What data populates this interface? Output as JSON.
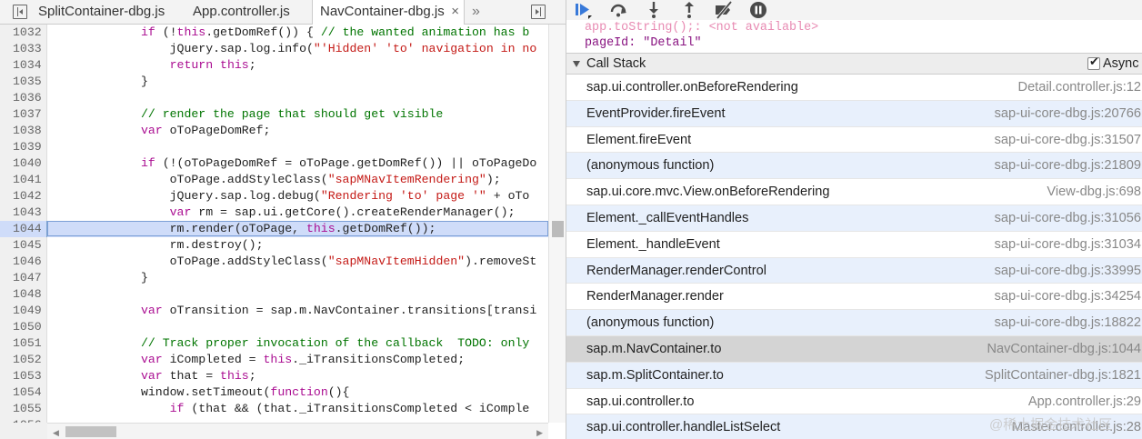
{
  "editor": {
    "tabs": [
      {
        "label": "SplitContainer-dbg.js",
        "active": false
      },
      {
        "label": "App.controller.js",
        "active": false
      },
      {
        "label": "NavContainer-dbg.js",
        "active": true
      }
    ],
    "tab_close": "×",
    "tab_overflow": "»",
    "code_lines": [
      {
        "num": "1032",
        "text": "            if (!this.getDomRef()) { // the wanted animation has b"
      },
      {
        "num": "1033",
        "text": "                jQuery.sap.log.info(\"'Hidden' 'to' navigation in no"
      },
      {
        "num": "1034",
        "text": "                return this;"
      },
      {
        "num": "1035",
        "text": "            }"
      },
      {
        "num": "1036",
        "text": ""
      },
      {
        "num": "1037",
        "text": "            // render the page that should get visible"
      },
      {
        "num": "1038",
        "text": "            var oToPageDomRef;"
      },
      {
        "num": "1039",
        "text": ""
      },
      {
        "num": "1040",
        "text": "            if (!(oToPageDomRef = oToPage.getDomRef()) || oToPageDo"
      },
      {
        "num": "1041",
        "text": "                oToPage.addStyleClass(\"sapMNavItemRendering\");"
      },
      {
        "num": "1042",
        "text": "                jQuery.sap.log.debug(\"Rendering 'to' page '\" + oTo"
      },
      {
        "num": "1043",
        "text": "                var rm = sap.ui.getCore().createRenderManager();"
      },
      {
        "num": "1044",
        "text": "                rm.render(oToPage, this.getDomRef());"
      },
      {
        "num": "1045",
        "text": "                rm.destroy();"
      },
      {
        "num": "1046",
        "text": "                oToPage.addStyleClass(\"sapMNavItemHidden\").removeSt"
      },
      {
        "num": "1047",
        "text": "            }"
      },
      {
        "num": "1048",
        "text": ""
      },
      {
        "num": "1049",
        "text": "            var oTransition = sap.m.NavContainer.transitions[transi"
      },
      {
        "num": "1050",
        "text": ""
      },
      {
        "num": "1051",
        "text": "            // Track proper invocation of the callback  TODO: only"
      },
      {
        "num": "1052",
        "text": "            var iCompleted = this._iTransitionsCompleted;"
      },
      {
        "num": "1053",
        "text": "            var that = this;"
      },
      {
        "num": "1054",
        "text": "            window.setTimeout(function(){"
      },
      {
        "num": "1055",
        "text": "                if (that && (that._iTransitionsCompleted < iComple"
      },
      {
        "num": "1056",
        "text": ""
      }
    ],
    "highlighted_line": "1044"
  },
  "debugger": {
    "scope": [
      {
        "text": "app.toString();: <not available>"
      },
      {
        "text": "pageId: \"Detail\""
      }
    ],
    "call_stack": {
      "title": "Call Stack",
      "async_label": "Async",
      "async_checked": true,
      "frames": [
        {
          "fn": "sap.ui.controller.onBeforeRendering",
          "loc": "Detail.controller.js:12"
        },
        {
          "fn": "EventProvider.fireEvent",
          "loc": "sap-ui-core-dbg.js:20766"
        },
        {
          "fn": "Element.fireEvent",
          "loc": "sap-ui-core-dbg.js:31507"
        },
        {
          "fn": "(anonymous function)",
          "loc": "sap-ui-core-dbg.js:21809"
        },
        {
          "fn": "sap.ui.core.mvc.View.onBeforeRendering",
          "loc": "View-dbg.js:698"
        },
        {
          "fn": "Element._callEventHandles",
          "loc": "sap-ui-core-dbg.js:31056"
        },
        {
          "fn": "Element._handleEvent",
          "loc": "sap-ui-core-dbg.js:31034"
        },
        {
          "fn": "RenderManager.renderControl",
          "loc": "sap-ui-core-dbg.js:33995"
        },
        {
          "fn": "RenderManager.render",
          "loc": "sap-ui-core-dbg.js:34254"
        },
        {
          "fn": "(anonymous function)",
          "loc": "sap-ui-core-dbg.js:18822"
        },
        {
          "fn": "sap.m.NavContainer.to",
          "loc": "NavContainer-dbg.js:1044"
        },
        {
          "fn": "sap.m.SplitContainer.to",
          "loc": "SplitContainer-dbg.js:1821"
        },
        {
          "fn": "sap.ui.controller.to",
          "loc": "App.controller.js:29"
        },
        {
          "fn": "sap.ui.controller.handleListSelect",
          "loc": "Master.controller.js:28"
        }
      ],
      "selected_index": 10
    }
  },
  "watermark": "@稀土掘金技术社区",
  "colors": {
    "selection": "#cfdcf9",
    "selected_frame": "#d4d4d4",
    "alt_row": "#e8f0fc",
    "toolbar_blue": "#3879d9",
    "toolbar_gray": "#4a4a4a"
  }
}
